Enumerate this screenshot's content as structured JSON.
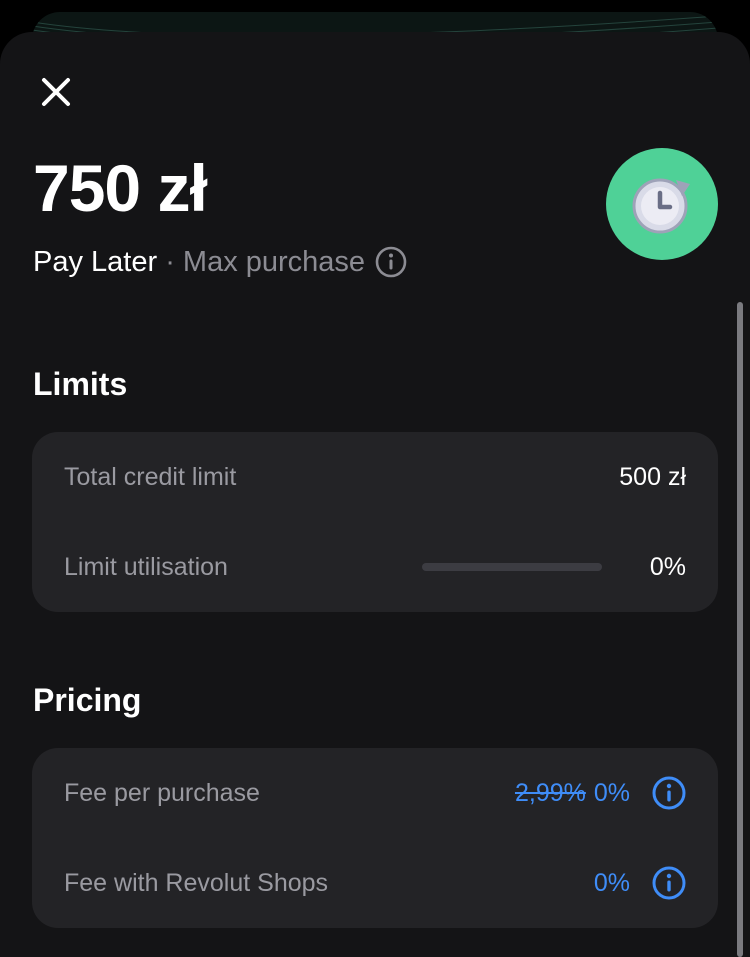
{
  "header": {
    "amount": "750 zł",
    "product_name": "Pay Later",
    "separator": " · ",
    "subtitle": "Max purchase",
    "badge_icon": "clock-refresh-icon",
    "badge_color": "#4fd197"
  },
  "limits": {
    "title": "Limits",
    "total_credit_limit_label": "Total credit limit",
    "total_credit_limit_value": "500 zł",
    "utilisation_label": "Limit utilisation",
    "utilisation_value": "0%",
    "utilisation_fraction": 0
  },
  "pricing": {
    "title": "Pricing",
    "fee_per_purchase_label": "Fee per purchase",
    "fee_per_purchase_old": "2,99%",
    "fee_per_purchase_value": "0%",
    "fee_revolut_shops_label": "Fee with Revolut Shops",
    "fee_revolut_shops_value": "0%"
  },
  "colors": {
    "accent_blue": "#3f8df8",
    "background": "#141416",
    "card": "#232326"
  }
}
